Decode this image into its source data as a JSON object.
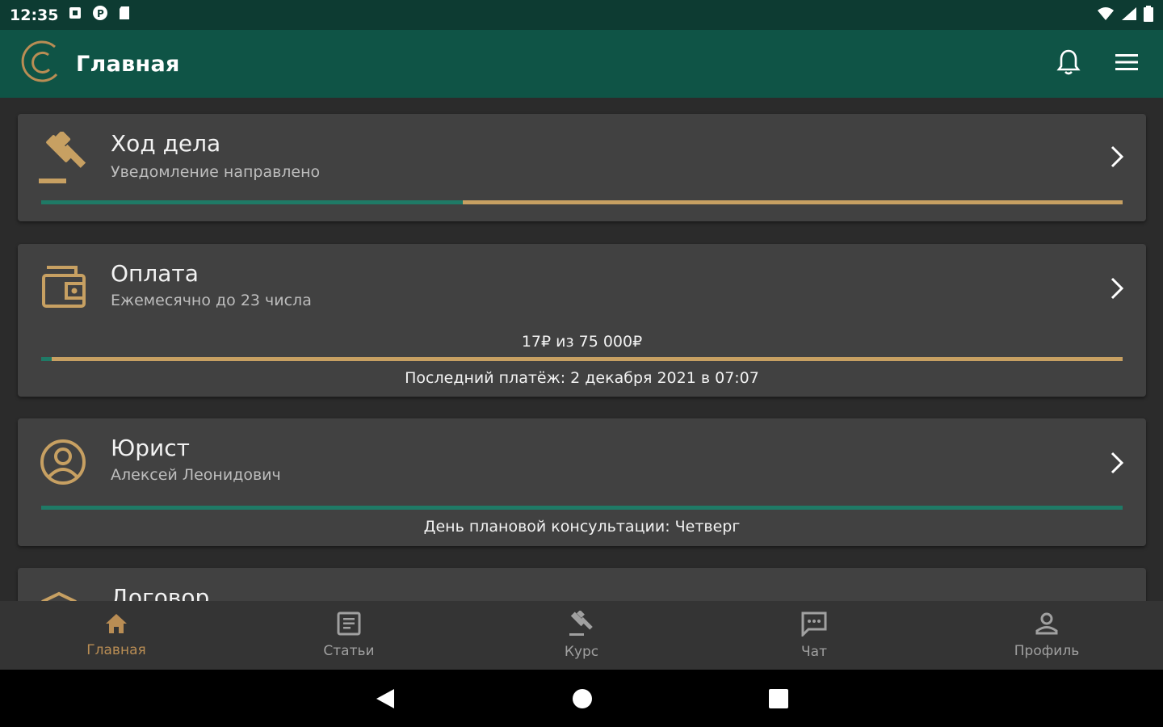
{
  "status_bar": {
    "time": "12:35"
  },
  "app_bar": {
    "title": "Главная"
  },
  "cards": {
    "case": {
      "title": "Ход дела",
      "subtitle": "Уведомление направлено",
      "progress": 0.39
    },
    "payment": {
      "title": "Оплата",
      "subtitle": "Ежемесячно до 23 числа",
      "amount_text": "17₽ из 75 000₽",
      "progress": 0.01,
      "last_payment": "Последний платёж: 2 декабря 2021 в 07:07"
    },
    "lawyer": {
      "title": "Юрист",
      "subtitle": "Алексей Леонидович",
      "progress": 1.0,
      "consultation": "День плановой консультации: Четверг"
    },
    "contract": {
      "title": "Договор"
    }
  },
  "bottom_nav": {
    "items": [
      {
        "label": "Главная",
        "icon": "home-icon"
      },
      {
        "label": "Статьи",
        "icon": "article-icon"
      },
      {
        "label": "Курс",
        "icon": "gavel-icon"
      },
      {
        "label": "Чат",
        "icon": "chat-icon"
      },
      {
        "label": "Профиль",
        "icon": "profile-icon"
      }
    ]
  },
  "colors": {
    "accent": "#c7a062",
    "teal": "#1f7a66",
    "app_bar": "#0f5446",
    "status_bar": "#0d3b32",
    "card": "#414141",
    "background": "#2b2b2b"
  }
}
